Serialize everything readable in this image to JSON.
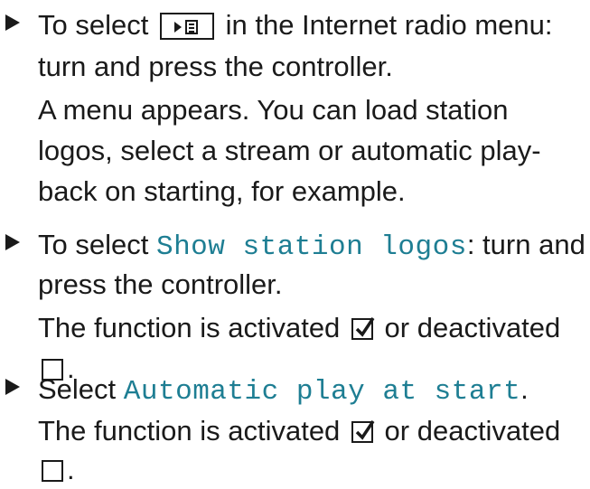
{
  "steps": [
    {
      "line1_pre": "To select",
      "icon": "play-list-icon",
      "line1_post": "in the Internet radio menu:",
      "line2": "turn and press the controller.",
      "line3": "A menu appears. You can load station",
      "line4": "logos, select a stream or automatic play-",
      "line5": "back on starting, for example."
    },
    {
      "line1_pre": "To select",
      "menu_item": "Show station logos",
      "line1_post": ": turn and",
      "line2": "press the controller.",
      "line3_pre": "The function is activated",
      "line3_post": "or deactivated",
      "line4_post": "."
    },
    {
      "line1_pre": "Select",
      "menu_item": "Automatic play at start",
      "line1_post": ".",
      "line2_pre": "The function is activated",
      "line2_post": "or deactivated",
      "line3_post": "."
    }
  ],
  "colors": {
    "menu_text": "#1e7e93",
    "text": "#1a1a1a"
  }
}
